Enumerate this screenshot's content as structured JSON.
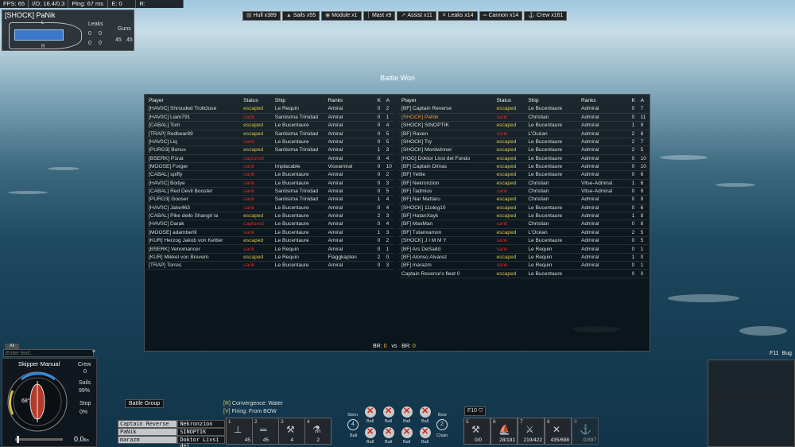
{
  "top_stats": [
    "FPS: 65",
    "I/O: 16.4/0.3",
    "Ping: 67 ms",
    "E: 0",
    "R:"
  ],
  "ship_panel": {
    "name": "[SHOCK] PaNik",
    "leaks_label": "Leaks",
    "guns_label": "Guns",
    "leaks": [
      "0",
      "0",
      "0",
      "0"
    ],
    "guns": [
      "45",
      "45"
    ],
    "hull_labels": [
      "L",
      "R"
    ]
  },
  "damage_bar": [
    {
      "icon": "hull-icon",
      "label": "Hull x389"
    },
    {
      "icon": "sails-icon",
      "label": "Sails x55"
    },
    {
      "icon": "module-icon",
      "label": "Module x1"
    },
    {
      "icon": "mast-icon",
      "label": "Mast x9"
    },
    {
      "icon": "assist-icon",
      "label": "Assist x11"
    },
    {
      "icon": "leaks-icon",
      "label": "Leaks x14"
    },
    {
      "icon": "cannon-icon",
      "label": "Cannon x14"
    },
    {
      "icon": "crew-icon",
      "label": "Crew x161"
    }
  ],
  "battle_title": "Battle Won",
  "headers": {
    "player": "Player",
    "status": "Status",
    "ship": "Ship",
    "ranks": "Ranks",
    "k": "K",
    "a": "A"
  },
  "team_left": [
    {
      "player": "[HAV0C] Shrouded Trollcluse",
      "status": "escaped",
      "ship": "Le Requin",
      "rank": "Amiral",
      "k": "0",
      "a": "2"
    },
    {
      "player": "[HAV0C] Liam791",
      "status": "sank",
      "ship": "Santisima Trinidad",
      "rank": "Amiral",
      "k": "0",
      "a": "1"
    },
    {
      "player": "[CABAL] Tom",
      "status": "escaped",
      "ship": "Le Bucentaure",
      "rank": "Amiral",
      "k": "0",
      "a": "4"
    },
    {
      "player": "[TRAP] Redbear89",
      "status": "escaped",
      "ship": "Santisima Trinidad",
      "rank": "Amiral",
      "k": "0",
      "a": "5"
    },
    {
      "player": "[HAV0C] Liq",
      "status": "sank",
      "ship": "Le Bucentaure",
      "rank": "Amiral",
      "k": "0",
      "a": "5"
    },
    {
      "player": "[PURG3] Bonus",
      "status": "escaped",
      "ship": "Santisima Trinidad",
      "rank": "Amiral",
      "k": "1",
      "a": "3"
    },
    {
      "player": "[BSERK] P1rat",
      "status": "captured",
      "ship": "",
      "rank": "Amiral",
      "k": "0",
      "a": "4"
    },
    {
      "player": "[MOOSE] Forger",
      "status": "sank",
      "ship": "Implacable",
      "rank": "Viceamiral",
      "k": "0",
      "a": "10"
    },
    {
      "player": "[CABAL] spiffy",
      "status": "sank",
      "ship": "Le Bucentaure",
      "rank": "Amiral",
      "k": "0",
      "a": "2"
    },
    {
      "player": "[HAV0C] Bodye",
      "status": "sank",
      "ship": "Le Bucentaure",
      "rank": "Amiral",
      "k": "0",
      "a": "3"
    },
    {
      "player": "[CABAL] Red Devil Booster",
      "status": "sank",
      "ship": "Santisima Trinidad",
      "rank": "Amiral",
      "k": "0",
      "a": "5"
    },
    {
      "player": "[PURG3] Gooser",
      "status": "sank",
      "ship": "Santisima Trinidad",
      "rank": "Amiral",
      "k": "1",
      "a": "4"
    },
    {
      "player": "[HAV0C] Jake463",
      "status": "sank",
      "ship": "Le Bucentaure",
      "rank": "Amiral",
      "k": "0",
      "a": "4"
    },
    {
      "player": "[CABAL] Pike dello Shangri la",
      "status": "escaped",
      "ship": "Le Bucentaure",
      "rank": "Amiral",
      "k": "2",
      "a": "3"
    },
    {
      "player": "[HAV0C] Darak",
      "status": "captured",
      "ship": "Le Bucentaure",
      "rank": "Amiral",
      "k": "0",
      "a": "4"
    },
    {
      "player": "[MOOSE] adamberlil",
      "status": "sank",
      "ship": "Le Bucentaure",
      "rank": "Amiral",
      "k": "1",
      "a": "3"
    },
    {
      "player": "[KUR] Herzog Jakob von Kettler",
      "status": "escaped",
      "ship": "Le Bucentaure",
      "rank": "Amiral",
      "k": "0",
      "a": "2"
    },
    {
      "player": "[BSERK] Venomancer",
      "status": "sank",
      "ship": "Le Requin",
      "rank": "Amiral",
      "k": "0",
      "a": "1"
    },
    {
      "player": "[KUR] Mikkel von Brevern",
      "status": "escaped",
      "ship": "Le Requin",
      "rank": "Flaggkapten",
      "k": "2",
      "a": "0"
    },
    {
      "player": "[TRAP] Torres",
      "status": "sank",
      "ship": "Le Bucentaure",
      "rank": "Amiral",
      "k": "0",
      "a": "3"
    }
  ],
  "team_right": [
    {
      "player": "[BF] Captain Reverse",
      "status": "escaped",
      "ship": "Le Bucentaure",
      "rank": "Admiral",
      "k": "0",
      "a": "7"
    },
    {
      "player": "[SHOCK] PaNik",
      "status": "sank",
      "ship": "Christian",
      "rank": "Admiral",
      "k": "0",
      "a": "11",
      "self": true
    },
    {
      "player": "[SHOCK] SINOPTIK",
      "status": "escaped",
      "ship": "Le Bucentaure",
      "rank": "Admiral",
      "k": "1",
      "a": "9"
    },
    {
      "player": "[BF] Raven",
      "status": "sank",
      "ship": "L'Océan",
      "rank": "Admiral",
      "k": "2",
      "a": "8"
    },
    {
      "player": "[SHOCK] Try",
      "status": "escaped",
      "ship": "Le Bucentaure",
      "rank": "Admiral",
      "k": "2",
      "a": "7"
    },
    {
      "player": "[SHOCK] Mordwinner",
      "status": "escaped",
      "ship": "Le Bucentaure",
      "rank": "Admiral",
      "k": "2",
      "a": "5"
    },
    {
      "player": "[HOG] Doktor Livsi del Fondo",
      "status": "escaped",
      "ship": "Le Bucentaure",
      "rank": "Admiral",
      "k": "0",
      "a": "10"
    },
    {
      "player": "[BF] Captain Dimas",
      "status": "escaped",
      "ship": "Le Bucentaure",
      "rank": "Admiral",
      "k": "0",
      "a": "10"
    },
    {
      "player": "[BF] Yettie",
      "status": "escaped",
      "ship": "Le Bucentaure",
      "rank": "Admiral",
      "k": "0",
      "a": "6"
    },
    {
      "player": "[BF] Nekronzion",
      "status": "escaped",
      "ship": "Christian",
      "rank": "Vitse-Admiral",
      "k": "1",
      "a": "6"
    },
    {
      "player": "[BF] Tadmius",
      "status": "sank",
      "ship": "Christian",
      "rank": "Vitse-Admiral",
      "k": "0",
      "a": "9"
    },
    {
      "player": "[BF] Nar Mattaru",
      "status": "escaped",
      "ship": "Christian",
      "rank": "Admiral",
      "k": "0",
      "a": "9"
    },
    {
      "player": "[SHOCK] 11oleg10",
      "status": "escaped",
      "ship": "Le Bucentaure",
      "rank": "Admiral",
      "k": "0",
      "a": "6"
    },
    {
      "player": "[BF] HatanXayk",
      "status": "escaped",
      "ship": "Le Bucentaure",
      "rank": "Admiral",
      "k": "1",
      "a": "8"
    },
    {
      "player": "[BF] MaxMan",
      "status": "sank",
      "ship": "Christian",
      "rank": "Admiral",
      "k": "0",
      "a": "6"
    },
    {
      "player": "[BF] Tutanxamon",
      "status": "escaped",
      "ship": "L'Océan",
      "rank": "Admiral",
      "k": "2",
      "a": "5"
    },
    {
      "player": "[SHOCK] J I M M Y",
      "status": "sank",
      "ship": "Le Bucentaure",
      "rank": "Admiral",
      "k": "0",
      "a": "5"
    },
    {
      "player": "[BF] Ars DeSadd",
      "status": "sank",
      "ship": "Le Requin",
      "rank": "Admiral",
      "k": "0",
      "a": "1"
    },
    {
      "player": "[BF] Alonso Alvarez",
      "status": "escaped",
      "ship": "Le Requin",
      "rank": "Admiral",
      "k": "1",
      "a": "0"
    },
    {
      "player": "[BF] marazm",
      "status": "sank",
      "ship": "Le Requin",
      "rank": "Admiral",
      "k": "0",
      "a": "1"
    },
    {
      "player": "Captain Reverse's fleet 0",
      "status": "escaped",
      "ship": "Le Bucentaure",
      "rank": "",
      "k": "0",
      "a": "0"
    }
  ],
  "br": {
    "label_left": "BR:",
    "value_left": "0",
    "vs": "vs",
    "label_right": "BR:",
    "value_right": "0"
  },
  "chat": {
    "tab": "All",
    "placeholder": "Enter text..."
  },
  "skipper": {
    "title": "Skipper Manual",
    "angle": "68°",
    "crew_label": "Crew",
    "crew": "0",
    "sails_label": "Sails",
    "sails": "99%",
    "stop_label": "Stop",
    "stop": "0%",
    "speed": "0.0",
    "speed_unit": "Kn",
    "rudder_marks": [
      "9",
      "-"
    ]
  },
  "battle_group": {
    "title": "Battle Group",
    "rows": [
      [
        "Captain Reverse",
        "Nekronzion"
      ],
      [
        "PaNik",
        "SINOPTIK"
      ],
      [
        "marazm",
        "Doktor Livsi del"
      ]
    ]
  },
  "orders": {
    "convergence_key": "[R]",
    "convergence": "Convergence: Water",
    "firing_key": "[V]",
    "firing": "Firing: From BOW"
  },
  "hotbar_left": [
    {
      "n": "1",
      "count": "45",
      "icon": "swivel-icon"
    },
    {
      "n": "2",
      "count": "45",
      "icon": "cannon-icon"
    },
    {
      "n": "3",
      "count": "4",
      "icon": "repair-icon"
    },
    {
      "n": "4",
      "count": "2",
      "icon": "flask-icon"
    }
  ],
  "cannon_panel": {
    "stern_label": "Stern",
    "stern_count": "4",
    "bow_label": "Bow",
    "bow_count": "2",
    "ball_label": "Ball",
    "chain_label": "Chain"
  },
  "key_hint": "F10",
  "hotbar_right": [
    {
      "n": "5",
      "count": "0/0",
      "icon": "hammer-icon"
    },
    {
      "n": "6",
      "count": "28/181",
      "icon": "sail-repair-icon"
    },
    {
      "n": "7",
      "count": "219/422",
      "icon": "crossed-swords-icon"
    },
    {
      "n": "8",
      "count": "435/698",
      "icon": "axes-icon"
    },
    {
      "n": "9",
      "count": "0/397",
      "icon": "hook-icon"
    }
  ],
  "minimap": {
    "header": "F11",
    "label": "Bug"
  }
}
